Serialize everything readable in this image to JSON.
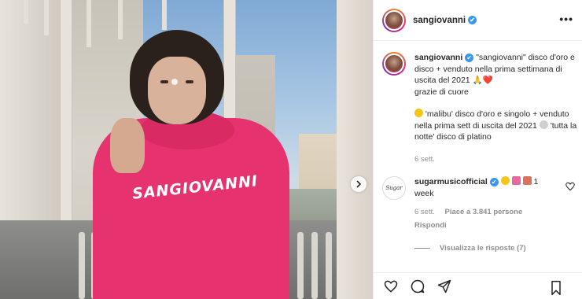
{
  "post": {
    "username": "sangiovanni",
    "verified_mark": "✔",
    "more_label": "•••",
    "hoodie_print": "SANGIOVANNI"
  },
  "caption": {
    "username": "sangiovanni",
    "line1": "\"sangiovanni\" disco d'oro e disco + venduto nella prima settimana di uscita del 2021 🙏❤️",
    "line2": "grazie di cuore",
    "para2_start": "'malibu' disco d'oro e singolo + venduto nella prima sett di uscita del 2021",
    "para2_end": "'tutta la notte' disco di platino",
    "time": "6 sett."
  },
  "reply": {
    "avatar_text": "Sugar",
    "username": "sugarmusicofficial",
    "text_tail": "1 week",
    "time": "6 sett.",
    "likes": "Piace a 3.841 persone",
    "reply_label": "Rispondi",
    "view_replies": "Visualizza le risposte (7)"
  },
  "colors": {
    "accent": "#3897f0",
    "hoodie": "#e6336f",
    "muted": "#8e8e8e"
  },
  "icons": [
    "heart-icon",
    "comment-icon",
    "share-icon",
    "bookmark-icon",
    "chevron-right-icon",
    "more-icon",
    "verified-icon"
  ]
}
